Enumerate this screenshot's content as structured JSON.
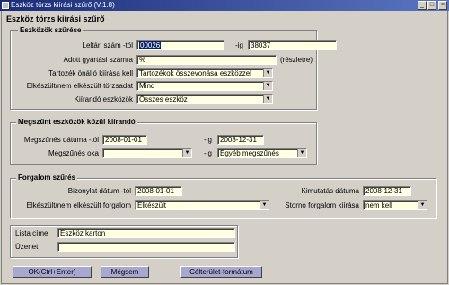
{
  "window": {
    "title": "Eszköz törzs kiírási szűrő (V.1.8)",
    "form_title": "Eszköz törzs kiírási szűrő"
  },
  "assets": {
    "legend": "Eszközök szűrése",
    "id_from_label": "Leltári szám -tól",
    "id_from_value": "00026",
    "id_to_label": "-ig",
    "id_to_value": "38037",
    "serial_label": "Adott gyártási számra",
    "serial_value": "%",
    "serial_hint": "(részletre)",
    "accessory_label": "Tartozék önálló kiírása kell",
    "accessory_value": "Tartozékok összevonása eszközzel",
    "completion_label": "Elkészült/nem elkészült törzsadat",
    "completion_value": "Mind",
    "printable_label": "Kiírandó eszközök",
    "printable_value": "Összes eszköz"
  },
  "discontinued": {
    "legend": "Megszűnt eszközök közül kiírandó",
    "date_from_label": "Megszűnés dátuma -tól",
    "date_from_value": "2008-01-01",
    "date_to_label": "-ig",
    "date_to_value": "2008-12-31",
    "reason_label": "Megszűnés oka",
    "reason_value": "",
    "reason_to_label": "-ig",
    "reason_to_value": "Egyéb megszűnés"
  },
  "traffic": {
    "legend": "Forgalom szűrés",
    "doc_date_label": "Bizonylat dátum -tól",
    "doc_date_value": "2008-01-01",
    "report_date_label": "Kimutatás dátuma",
    "report_date_value": "2008-12-31",
    "completion_label": "Elkészült/nem elkészült forgalom",
    "completion_value": "Elkészült",
    "storno_label": "Storno forgalom kiírása",
    "storno_value": "nem kell"
  },
  "list": {
    "title_label": "Lista címe",
    "title_value": "Eszköz karton",
    "message_label": "Üzenet",
    "message_value": ""
  },
  "buttons": {
    "ok": "OK(Ctrl+Enter)",
    "cancel": "Mégsem",
    "format": "Célterület-formátum"
  }
}
